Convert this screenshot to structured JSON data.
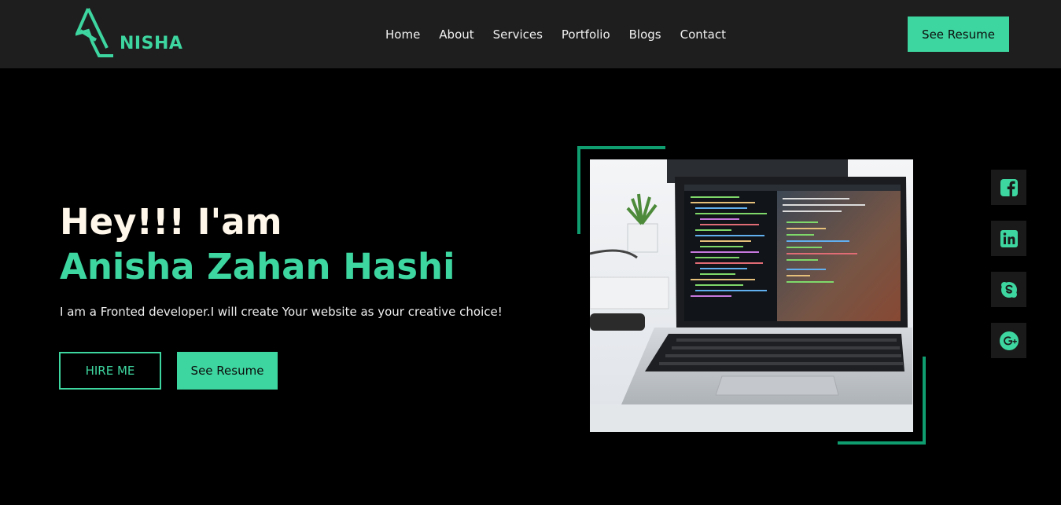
{
  "brand": {
    "logo_text": "NISHA",
    "accent_color": "#3ed6a0"
  },
  "nav": {
    "links": [
      "Home",
      "About",
      "Services",
      "Portfolio",
      "Blogs",
      "Contact"
    ],
    "resume_label": "See Resume"
  },
  "hero": {
    "greeting": "Hey!!! I'am",
    "name": "Anisha Zahan Hashi",
    "subtitle": "I am a Fronted developer.I will create Your website as your creative choice!",
    "hire_label": "HIRE ME",
    "resume_label": "See Resume",
    "image": "laptop-with-code-photo"
  },
  "social": {
    "icons": [
      "facebook-icon",
      "linkedin-icon",
      "skype-icon",
      "google-plus-icon"
    ]
  }
}
